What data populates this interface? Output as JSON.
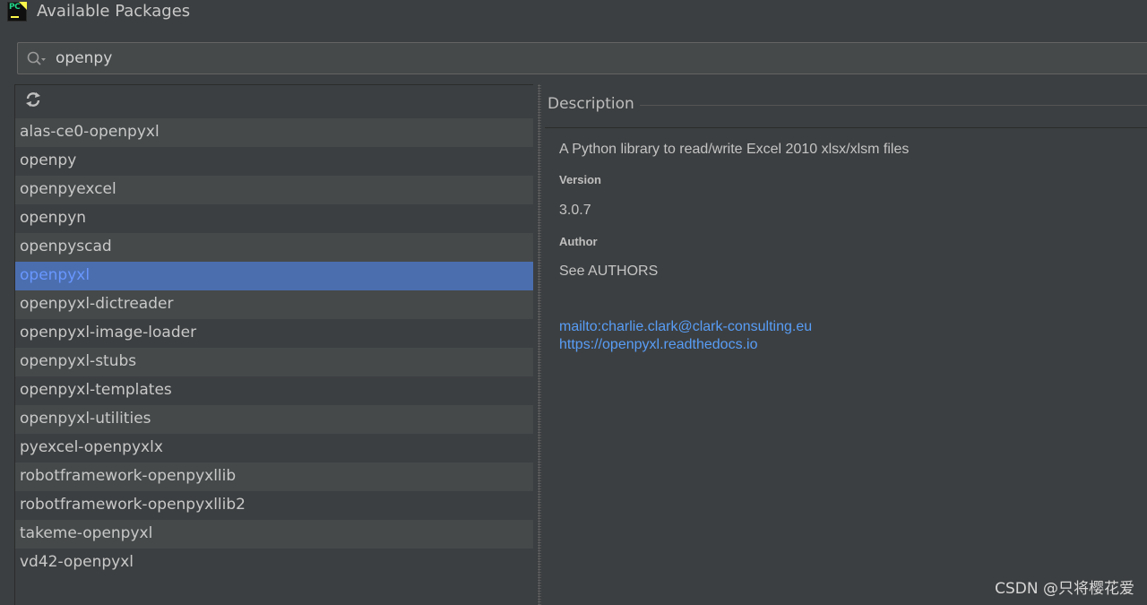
{
  "window": {
    "title": "Available Packages",
    "app_icon": "pycharm-icon",
    "app_icon_text": "PC"
  },
  "search": {
    "value": "openpy",
    "icon": "search-icon"
  },
  "packages": {
    "refresh_icon": "refresh-icon",
    "selected_index": 5,
    "items": [
      "alas-ce0-openpyxl",
      "openpy",
      "openpyexcel",
      "openpyn",
      "openpyscad",
      "openpyxl",
      "openpyxl-dictreader",
      "openpyxl-image-loader",
      "openpyxl-stubs",
      "openpyxl-templates",
      "openpyxl-utilities",
      "pyexcel-openpyxlx",
      "robotframework-openpyxllib",
      "robotframework-openpyxllib2",
      "takeme-openpyxl",
      "vd42-openpyxl"
    ]
  },
  "description": {
    "header": "Description",
    "summary": "A Python library to read/write Excel 2010 xlsx/xlsm files",
    "version_label": "Version",
    "version": "3.0.7",
    "author_label": "Author",
    "author": "See AUTHORS",
    "links": [
      "mailto:charlie.clark@clark-consulting.eu",
      "https://openpyxl.readthedocs.io"
    ]
  },
  "watermark": "CSDN @只将樱花爱",
  "colors": {
    "background": "#3c3f41",
    "selection": "#4b6eaf",
    "selected_text": "#6897ff",
    "link": "#589df6"
  }
}
